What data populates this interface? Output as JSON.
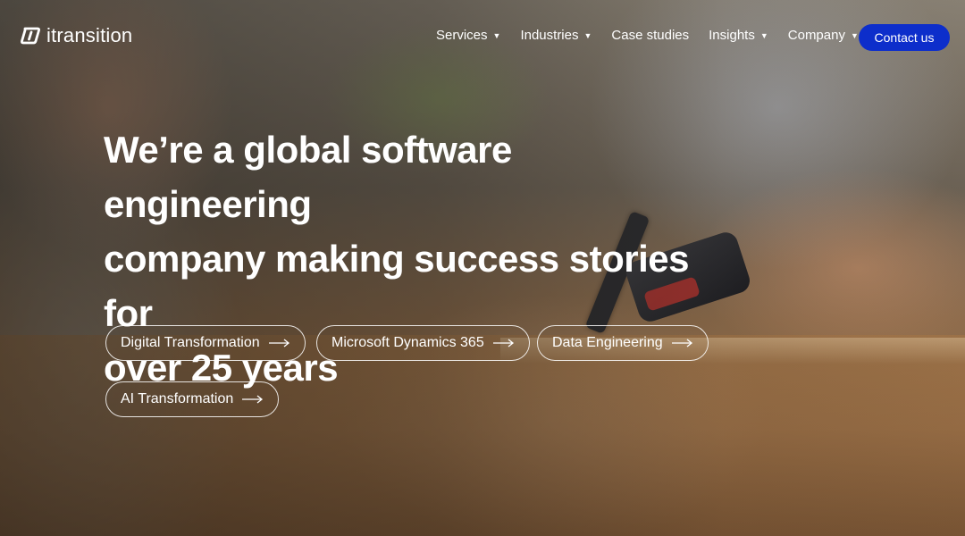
{
  "brand": {
    "name": "itransition"
  },
  "nav": {
    "items": [
      {
        "label": "Services",
        "has_dropdown": true
      },
      {
        "label": "Industries",
        "has_dropdown": true
      },
      {
        "label": "Case studies",
        "has_dropdown": false
      },
      {
        "label": "Insights",
        "has_dropdown": true
      },
      {
        "label": "Company",
        "has_dropdown": true
      }
    ],
    "contact_label": "Contact us"
  },
  "hero": {
    "headline_lines": [
      "We’re a global software engineering",
      "company making success stories for",
      "over 25 years"
    ],
    "pills": [
      {
        "label": "Digital Transformation"
      },
      {
        "label": "Microsoft Dynamics 365"
      },
      {
        "label": "Data Engineering"
      },
      {
        "label": "AI Transformation"
      }
    ]
  },
  "colors": {
    "accent": "#0d2ecb",
    "text": "#ffffff"
  },
  "icons": {
    "dropdown": "chevron-down-icon",
    "arrow": "arrow-right-icon",
    "logo": "itransition-logo-icon"
  }
}
